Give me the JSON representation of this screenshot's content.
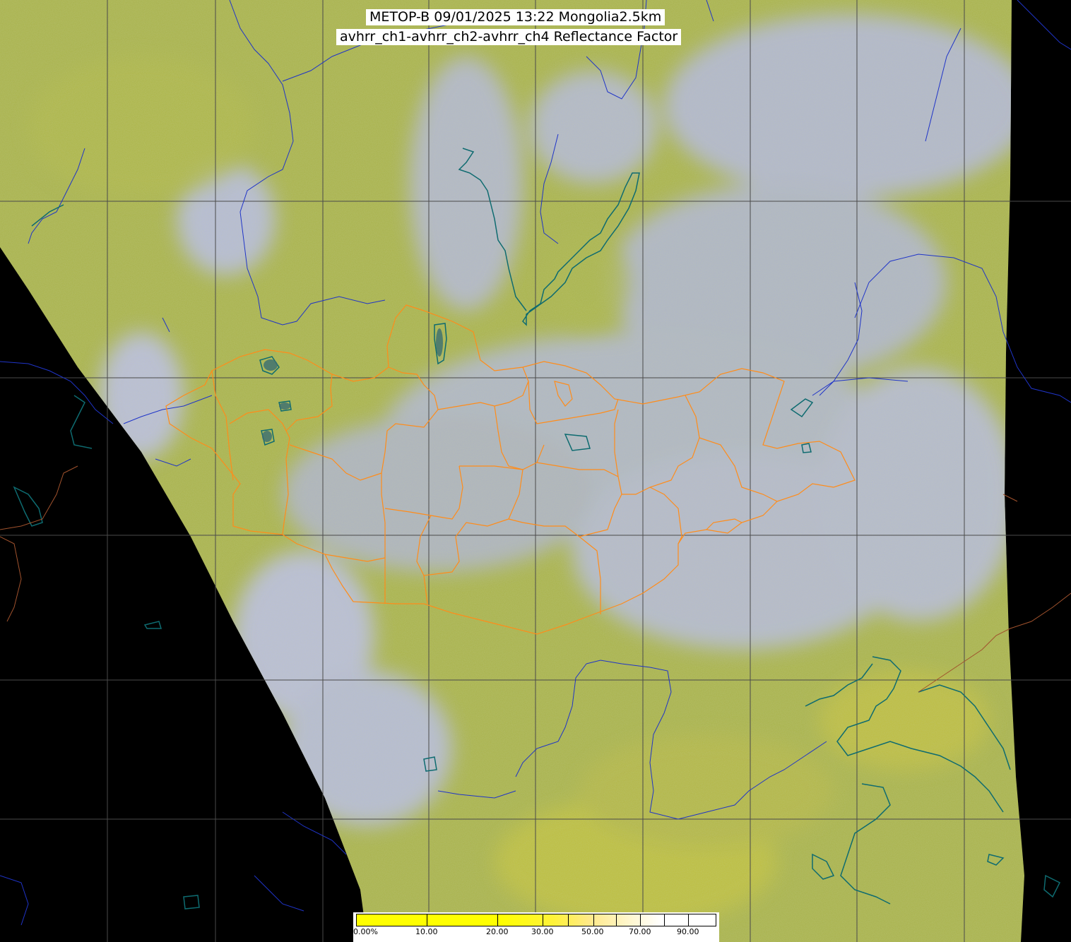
{
  "title": {
    "line1": "METOP-B 09/01/2025 13:22 Mongolia2.5km",
    "line2": "avhrr_ch1-avhrr_ch2-avhrr_ch4 Reflectance Factor"
  },
  "colorbar": {
    "labels": [
      "0.00%",
      "10.00",
      "20.00",
      "30.00",
      "50.00",
      "70.00",
      "90.00"
    ],
    "colors": [
      "#ffff00",
      "#ffff00",
      "#fff23a",
      "#ffe98a",
      "#fff6c8",
      "#ffffff"
    ]
  },
  "colors": {
    "land_base": "#a9b34a",
    "cloud": "#b8bdf2",
    "nodata": "#000000",
    "grid": "#4a4a4a",
    "rivers": "#1f34c8",
    "coast_lakes": "#0e6b70",
    "admin_borders": "#ff8c1a",
    "country_borders": "#a0522d"
  }
}
